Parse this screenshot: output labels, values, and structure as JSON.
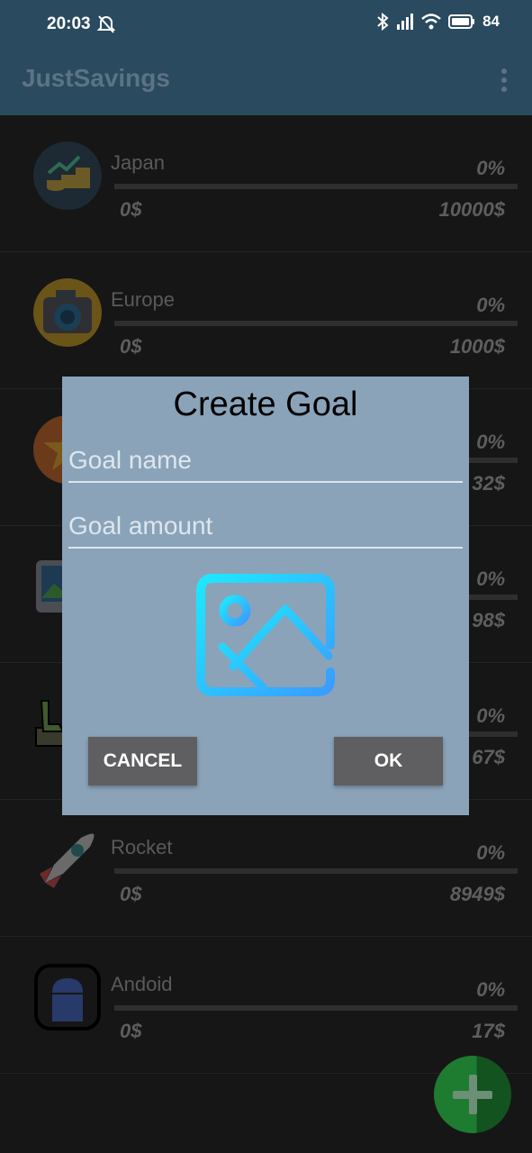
{
  "status_bar": {
    "time": "20:03",
    "battery": "84"
  },
  "app_bar": {
    "title": "JustSavings"
  },
  "goals": [
    {
      "name": "Japan",
      "percent": "0%",
      "current": "0$",
      "target": "10000$",
      "icon": "savings-coins-icon"
    },
    {
      "name": "Europe",
      "percent": "0%",
      "current": "0$",
      "target": "1000$",
      "icon": "camera-icon"
    },
    {
      "name": "",
      "percent": "0%",
      "current": "",
      "target": "32$",
      "icon": "star-icon"
    },
    {
      "name": "",
      "percent": "0%",
      "current": "",
      "target": "98$",
      "icon": "picture-icon"
    },
    {
      "name": "",
      "percent": "0%",
      "current": "",
      "target": "67$",
      "icon": "dinosaur-icon"
    },
    {
      "name": "Rocket",
      "percent": "0%",
      "current": "0$",
      "target": "8949$",
      "icon": "rocket-icon"
    },
    {
      "name": "Andoid",
      "percent": "0%",
      "current": "0$",
      "target": "17$",
      "icon": "android-icon"
    }
  ],
  "dialog": {
    "title": "Create Goal",
    "name_placeholder": "Goal name",
    "amount_placeholder": "Goal amount",
    "image_icon": "image-placeholder-icon",
    "cancel_label": "CANCEL",
    "ok_label": "OK"
  },
  "fab": {
    "icon": "plus-icon"
  },
  "colors": {
    "app_bar": "#2a4a60",
    "dialog_bg": "#8aa3b9",
    "button_bg": "#5f5f61",
    "fab_green": "#1e7c30",
    "image_icon_gradient": [
      "#1ee8ff",
      "#3a9cff"
    ]
  }
}
